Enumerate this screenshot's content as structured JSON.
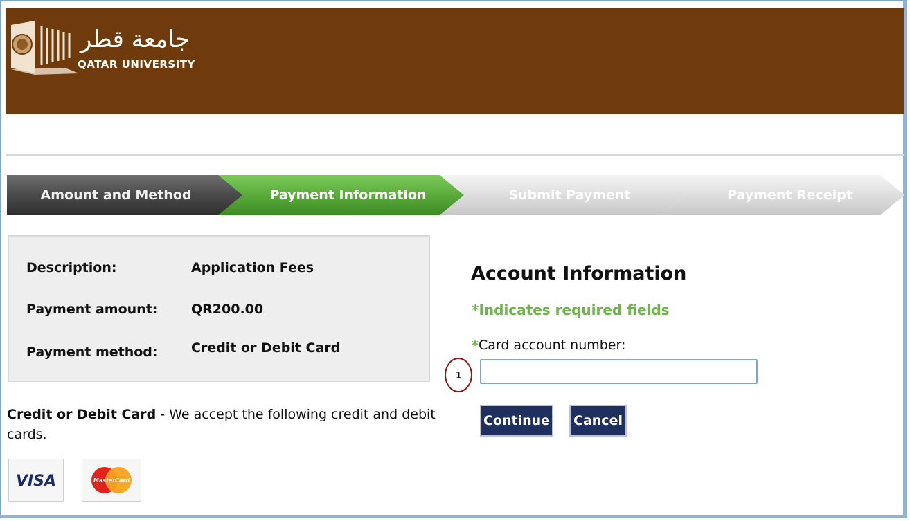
{
  "header": {
    "logo_ar": "جامعة قطر",
    "logo_en": "QATAR UNIVERSITY",
    "bg_color": "#6f3b0c"
  },
  "steps": [
    {
      "label": "Amount and Method",
      "state": "done",
      "color": "#555555"
    },
    {
      "label": "Payment Information",
      "state": "active",
      "color": "#5aab3a"
    },
    {
      "label": "Submit Payment",
      "state": "pending",
      "color": "#dddddd"
    },
    {
      "label": "Payment Receipt",
      "state": "pending",
      "color": "#dddddd"
    }
  ],
  "summary": {
    "description_label": "Description:",
    "description_value": "Application Fees",
    "amount_label": "Payment amount:",
    "amount_value": "QR200.00",
    "method_label": "Payment method:",
    "method_value": "Credit or Debit Card"
  },
  "note": {
    "bold": "Credit or Debit Card",
    "text": " - We accept the following credit and debit cards."
  },
  "cards": [
    {
      "name": "VISA",
      "icon": "visa-icon"
    },
    {
      "name": "MasterCard",
      "icon": "mastercard-icon"
    }
  ],
  "account": {
    "title": "Account Information",
    "required_note": "*Indicates required fields",
    "field_star": "*",
    "field_label": "Card account number:",
    "field_value": "",
    "callout": "1"
  },
  "buttons": {
    "continue": "Continue",
    "cancel": "Cancel"
  }
}
